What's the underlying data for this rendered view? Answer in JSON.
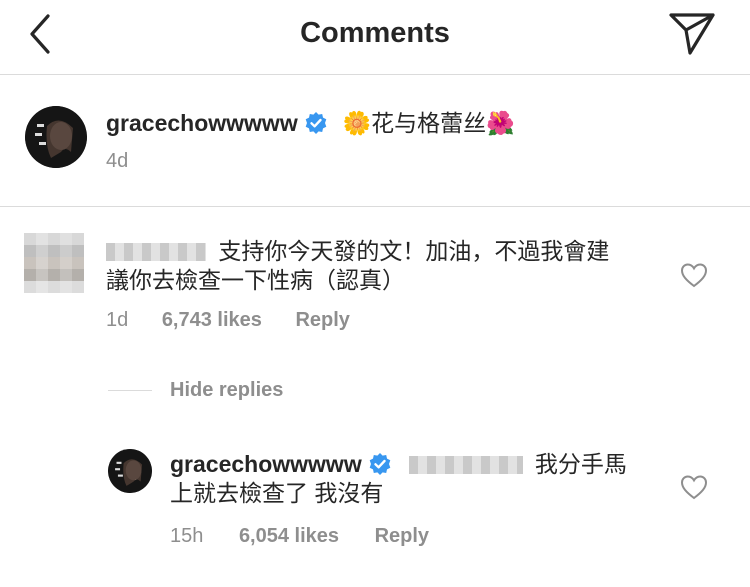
{
  "header": {
    "title": "Comments",
    "back_icon": "chevron-left-icon",
    "share_icon": "send-icon"
  },
  "caption": {
    "username": "gracechowwwww",
    "text": "🌼花与格蕾丝🌺",
    "time": "4d"
  },
  "comment": {
    "text_line1": "支持你今天發的文！加油，不過我會建",
    "text_line2": "議你去檢查一下性病（認真）",
    "time": "1d",
    "likes": "6,743 likes",
    "reply": "Reply"
  },
  "hide_replies": "Hide replies",
  "reply_comment": {
    "username": "gracechowwwww",
    "text_line1": "我分手馬",
    "text_line2": "上就去檢查了 我沒有",
    "time": "15h",
    "likes": "6,054 likes",
    "reply": "Reply"
  },
  "colors": {
    "verified": "#3897f0",
    "divider": "#dbdbdb",
    "meta_text": "#8e8e8e"
  }
}
